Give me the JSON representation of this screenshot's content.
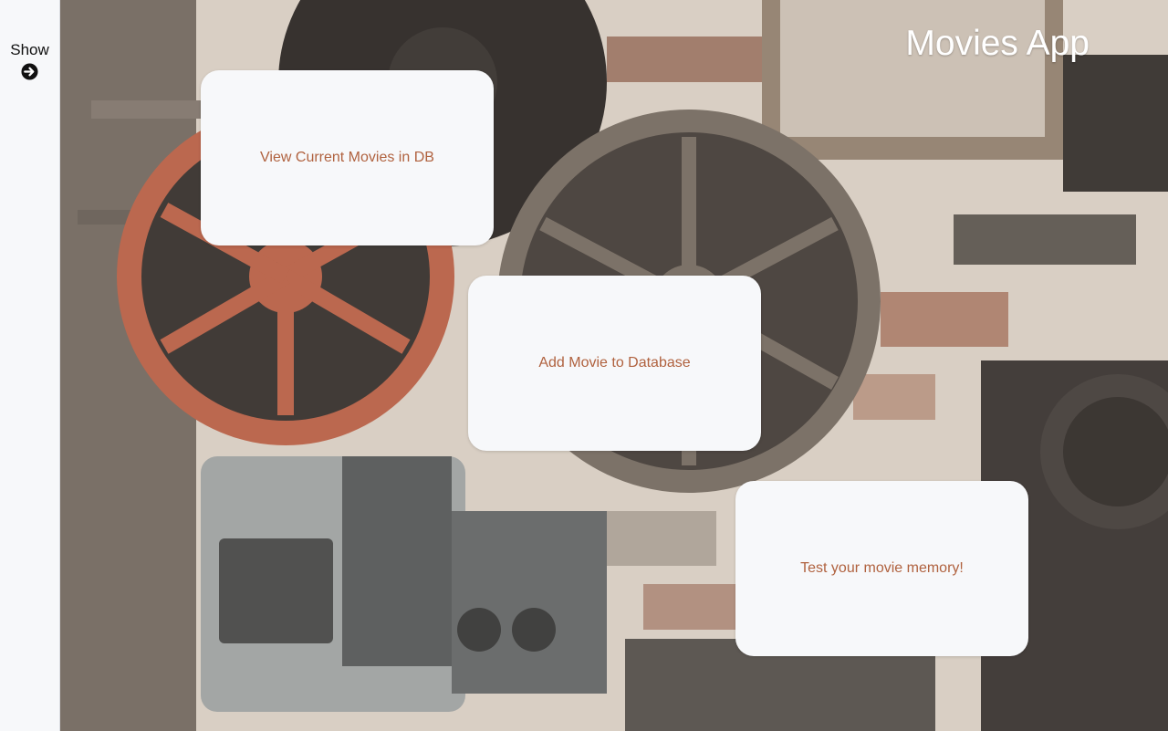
{
  "app": {
    "title": "Movies App"
  },
  "sidebar": {
    "toggle_label": "Show",
    "toggle_icon": "arrow-right-circle-icon"
  },
  "cards": [
    {
      "label": "View Current Movies in DB"
    },
    {
      "label": "Add Movie to Database"
    },
    {
      "label": "Test your movie memory!"
    }
  ],
  "colors": {
    "card_background": "#f7f8fa",
    "card_text": "#b0623f",
    "title_text": "#ffffff",
    "sidebar_background": "#f7f8fa"
  }
}
